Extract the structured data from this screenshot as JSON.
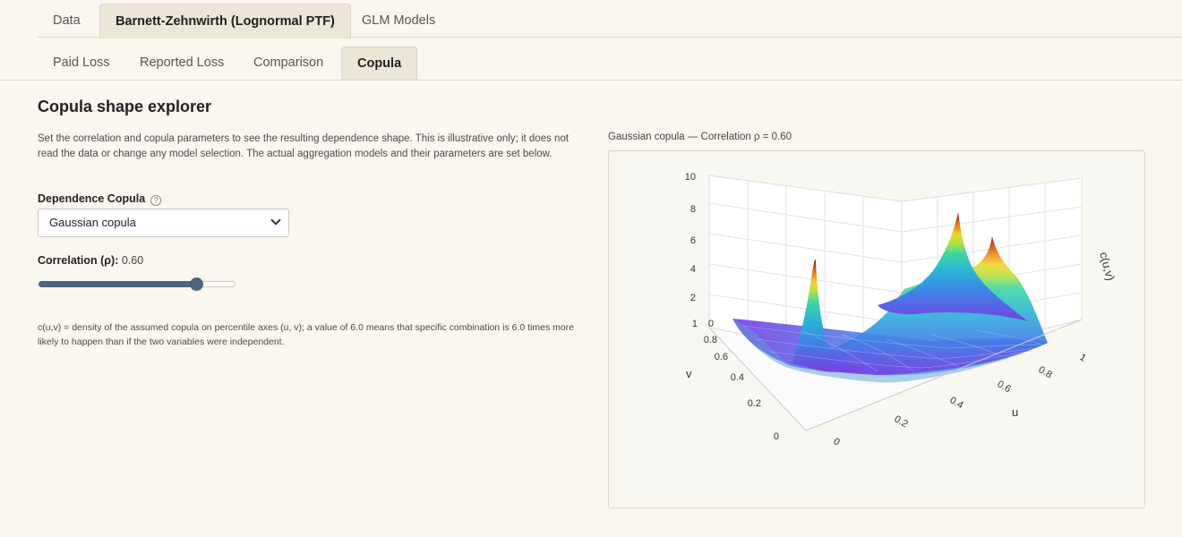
{
  "top_tabs": [
    {
      "label": "Data",
      "active": false
    },
    {
      "label": "Barnett-Zehnwirth (Lognormal PTF)",
      "active": true
    },
    {
      "label": "GLM Models",
      "active": false
    }
  ],
  "sub_tabs": [
    {
      "label": "Paid Loss",
      "active": false
    },
    {
      "label": "Reported Loss",
      "active": false
    },
    {
      "label": "Comparison",
      "active": false
    },
    {
      "label": "Copula",
      "active": true
    }
  ],
  "main": {
    "title": "Copula shape explorer",
    "description": "Set the correlation and copula parameters to see the resulting dependence shape. This is illustrative only; it does not read the data or change any model selection. The actual aggregation models and their parameters are set below.",
    "copula_label": "Dependence Copula",
    "help_icon": "question-circle-icon",
    "copula_selected": "Gaussian copula",
    "correlation_label": "Correlation (ρ):",
    "correlation_value": "0.60",
    "slider_fraction": 0.8,
    "note": "c(u,v) = density of the assumed copula on percentile axes (u, v); a value of 6.0 means that specific combination is 6.0 times more likely to happen than if the two variables were independent."
  },
  "plot": {
    "caption": "Gaussian copula — Correlation ρ = 0.60",
    "z_ticks": [
      "10",
      "8",
      "6",
      "4",
      "2",
      "0"
    ],
    "v_ticks": [
      "1",
      "0.8",
      "0.6",
      "0.4",
      "0.2",
      "0"
    ],
    "u_ticks": [
      "0",
      "0.2",
      "0.4",
      "0.6",
      "0.8",
      "1"
    ],
    "z_title": "c(u,v)",
    "v_title": "v",
    "u_title": "u",
    "colors": {
      "low": "#7b3fe4",
      "mid": "#2ab3d8",
      "high": "#8b0d0d"
    }
  }
}
